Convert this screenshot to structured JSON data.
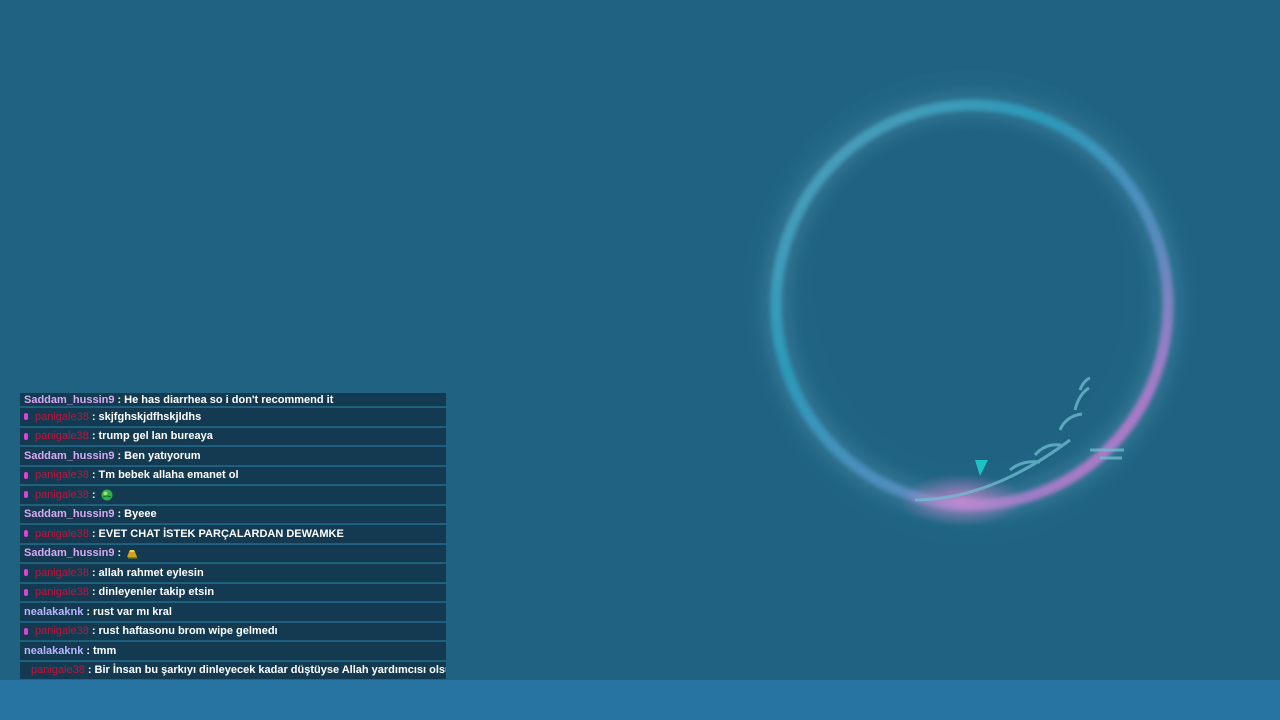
{
  "chat": {
    "messages": [
      {
        "user": "Saddam_hussin9",
        "text": "He has diarrhea so i don't recommend it"
      },
      {
        "user": "panigale38",
        "text": "skjfghskjdfhskjldhs"
      },
      {
        "user": "panigale38",
        "text": "trump gel lan bureaya"
      },
      {
        "user": "Saddam_hussin9",
        "text": "Ben yatıyorum"
      },
      {
        "user": "panigale38",
        "text": "Tm bebek allaha emanet ol"
      },
      {
        "user": "panigale38",
        "text": "",
        "emote": "green-globe-emote"
      },
      {
        "user": "Saddam_hussin9",
        "text": "Byeee"
      },
      {
        "user": "panigale38",
        "text": "EVET CHAT İSTEK PARÇALARDAN DEWAMKE"
      },
      {
        "user": "Saddam_hussin9",
        "text": "",
        "emote": "gold-bar-emote"
      },
      {
        "user": "panigale38",
        "text": "allah rahmet eylesin"
      },
      {
        "user": "panigale38",
        "text": "dinleyenler takip etsin"
      },
      {
        "user": "nealakaknk",
        "text": "rust var mı kral"
      },
      {
        "user": "panigale38",
        "text": "rust haftasonu brom wipe gelmedı"
      },
      {
        "user": "nealakaknk",
        "text": "tmm"
      },
      {
        "user": "panigale38",
        "text": "Bir İnsan bu şarkıyı dinleyecek kadar düştüyse Allah yardımcısı olsun"
      }
    ],
    "separator": ":",
    "mic_icon": "microphone-icon"
  },
  "colors": {
    "background": "#1f6282",
    "bottom_bar": "#2773a1",
    "chat_row": "#133a51",
    "user_panigale": "#c0143c",
    "user_saddam": "#d8a8f0",
    "user_neal": "#b9b6ff",
    "mic": "#e040d8"
  }
}
